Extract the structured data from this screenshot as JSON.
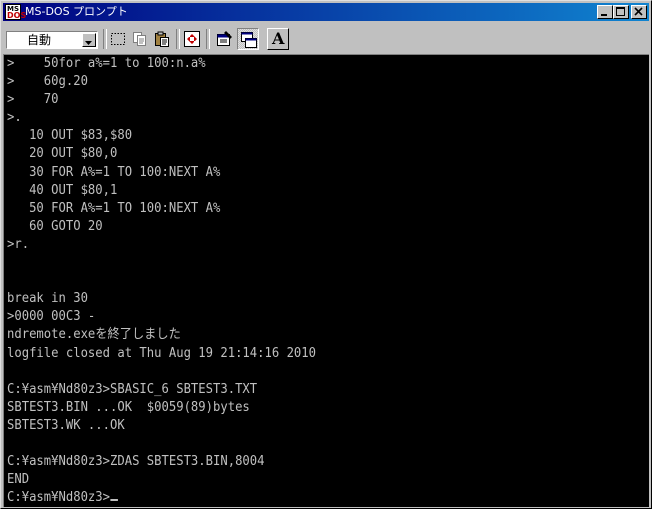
{
  "window": {
    "title": "MS-DOS プロンプト",
    "title_color_start": "#000080",
    "title_color_end": "#1084d0"
  },
  "toolbar": {
    "font_size_value": "自動",
    "buttons": [
      "mark-icon",
      "copy-icon",
      "paste-icon",
      "fullscreen-icon",
      "properties-icon",
      "background-icon",
      "font-icon"
    ],
    "font_button_label": "A"
  },
  "console": {
    "background": "#000000",
    "foreground": "#c0c0c0",
    "lines": [
      ">    50for a%=1 to 100:n.a%",
      ">    60g.20",
      ">    70",
      ">.",
      "   10 OUT $83,$80",
      "   20 OUT $80,0",
      "   30 FOR A%=1 TO 100:NEXT A%",
      "   40 OUT $80,1",
      "   50 FOR A%=1 TO 100:NEXT A%",
      "   60 GOTO 20",
      ">r.",
      "",
      "",
      "break in 30",
      ">0000 00C3 -",
      "ndremote.exeを終了しました",
      "logfile closed at Thu Aug 19 21:14:16 2010",
      "",
      "C:¥asm¥Nd80z3>SBASIC_6 SBTEST3.TXT",
      "SBTEST3.BIN ...OK  $0059(89)bytes",
      "SBTEST3.WK ...OK",
      "",
      "C:¥asm¥Nd80z3>ZDAS SBTEST3.BIN,8004",
      "END",
      "C:¥asm¥Nd80z3>"
    ]
  }
}
